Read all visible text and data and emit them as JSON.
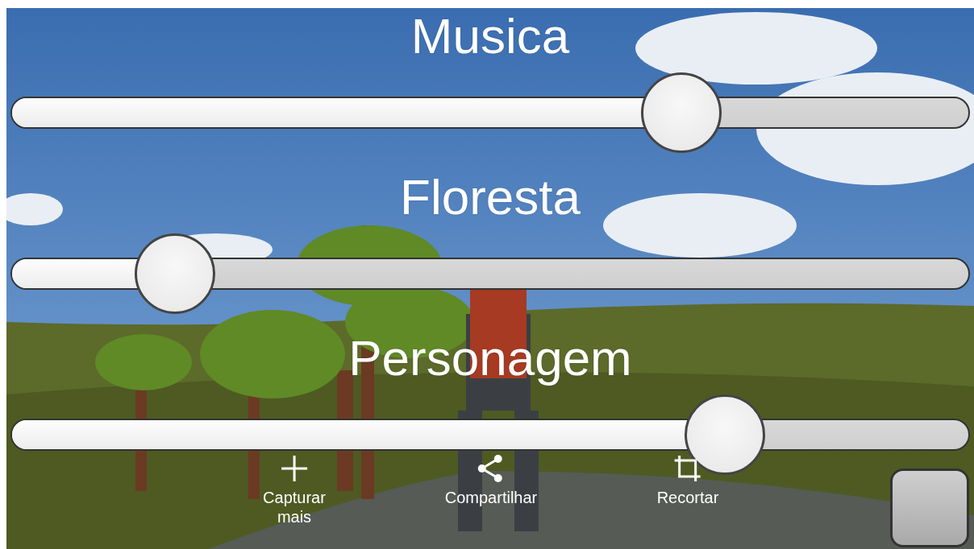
{
  "sliders": [
    {
      "label": "Musica",
      "level": 0.7
    },
    {
      "label": "Floresta",
      "level": 0.17
    },
    {
      "label": "Personagem",
      "level": 0.745
    }
  ],
  "toolbar": [
    {
      "kind": "add",
      "label": "Capturar\nmais"
    },
    {
      "kind": "share",
      "label": "Compartilhar"
    },
    {
      "kind": "crop",
      "label": "Recortar"
    }
  ]
}
